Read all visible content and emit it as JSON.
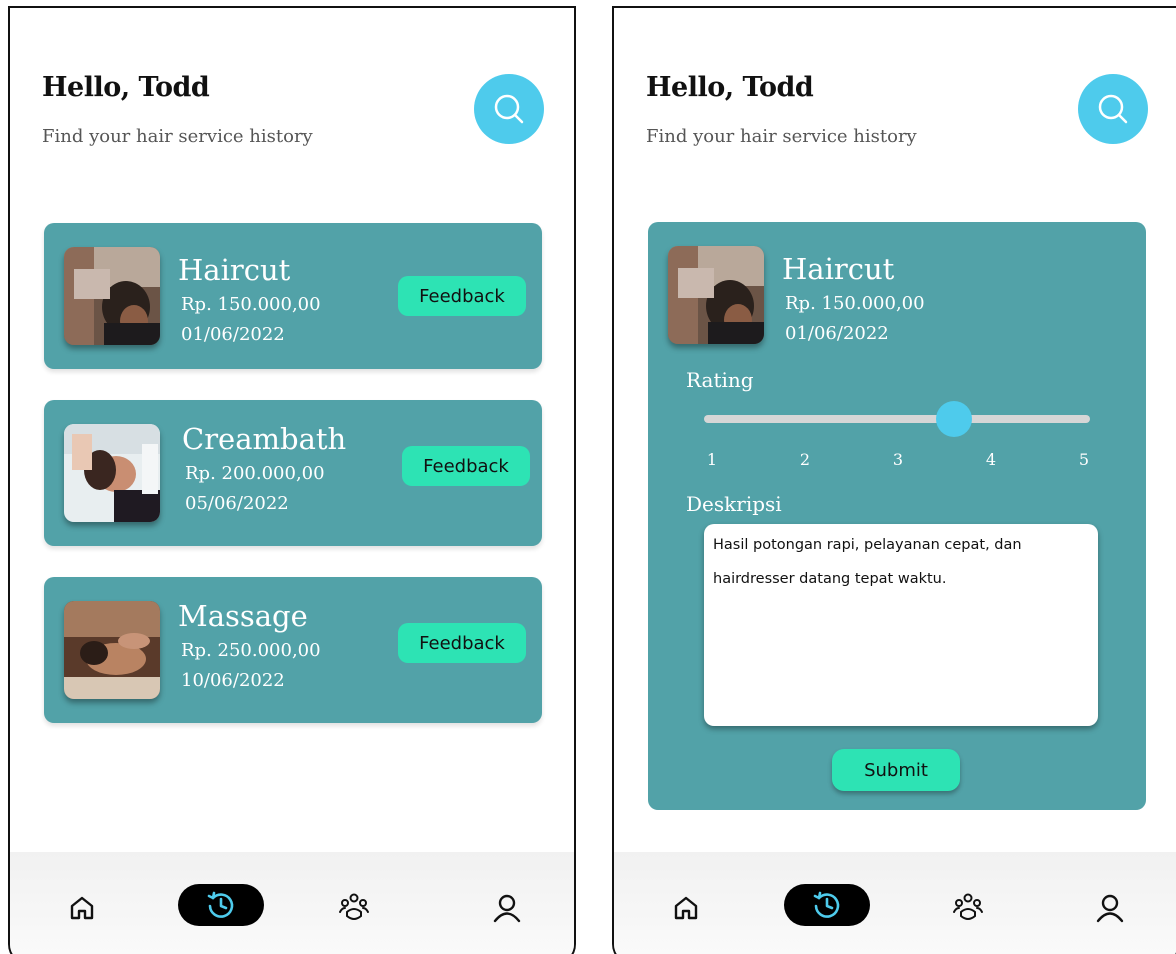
{
  "left_screen": {
    "greeting": "Hello, Todd",
    "subtitle": "Find your hair service history",
    "services": [
      {
        "title": "Haircut",
        "price": "Rp. 150.000,00",
        "date": "01/06/2022",
        "button": "Feedback",
        "image": "haircut-photo"
      },
      {
        "title": "Creambath",
        "price": "Rp. 200.000,00",
        "date": "05/06/2022",
        "button": "Feedback",
        "image": "creambath-photo"
      },
      {
        "title": "Massage",
        "price": "Rp. 250.000,00",
        "date": "10/06/2022",
        "button": "Feedback",
        "image": "massage-photo"
      }
    ]
  },
  "right_screen": {
    "greeting": "Hello, Todd",
    "subtitle": "Find your hair service history",
    "service": {
      "title": "Haircut",
      "price": "Rp. 150.000,00",
      "date": "01/06/2022",
      "image": "haircut-photo"
    },
    "rating_label": "Rating",
    "rating_ticks": [
      "1",
      "2",
      "3",
      "4",
      "5"
    ],
    "rating_value": 3.6,
    "description_label": "Deskripsi",
    "description_text": "Hasil potongan rapi, pelayanan cepat, dan hairdresser datang tepat waktu.",
    "submit_label": "Submit"
  },
  "navbar": {
    "items": [
      "home-icon",
      "history-icon",
      "community-icon",
      "profile-icon"
    ],
    "active": "history-icon"
  },
  "colors": {
    "card": "#52a2a8",
    "accent_button": "#2de3b4",
    "search_button": "#4ecbec",
    "nav_active": "#000000"
  }
}
